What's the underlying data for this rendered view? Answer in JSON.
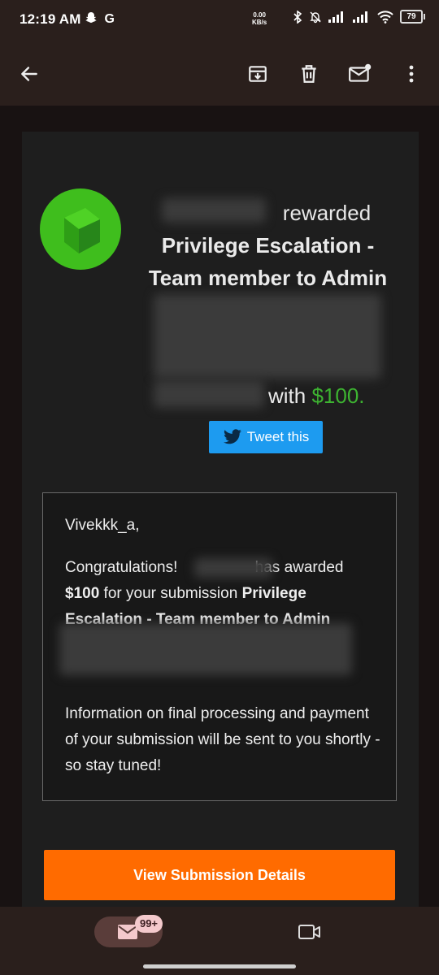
{
  "status_bar": {
    "time": "12:19 AM",
    "left_icons": [
      "snapchat-icon",
      "google-icon"
    ],
    "left_letter": "G",
    "speed_value": "0.00",
    "speed_unit": "KB/s",
    "right_icons": [
      "bluetooth-icon",
      "mute-icon",
      "signal-icon",
      "signal-icon",
      "wifi-icon",
      "battery-icon"
    ],
    "battery": "79"
  },
  "app_bar": {
    "icons": [
      "back-arrow-icon",
      "archive-icon",
      "delete-icon",
      "mark-unread-icon",
      "more-vert-icon"
    ]
  },
  "email": {
    "headline_prefix": "rewarded",
    "headline_title": "Privilege Escalation - Team member to Admin",
    "with_text": "with ",
    "amount": "$100.",
    "tweet_label": "Tweet this",
    "greeting": "Vivekkk_a,",
    "congrats_lead": "Congratulations! ",
    "congrats_mid": "has awarded",
    "congrats_amount": "$100",
    "congrats_for": " for your submission ",
    "congrats_title": "Privilege Escalation - Team member to Admin",
    "info_text": "Information on final processing and payment of your submission will be sent to you shortly - so stay tuned!",
    "cta_label": "View Submission Details"
  },
  "bottom_nav": {
    "mail_badge": "99+",
    "icons": [
      "mail-icon",
      "video-icon"
    ]
  },
  "colors": {
    "accent_orange": "#ff6b00",
    "amount_green": "#3db331",
    "tweet_blue": "#1d9bf0",
    "avatar_green": "#3fbe1d"
  }
}
